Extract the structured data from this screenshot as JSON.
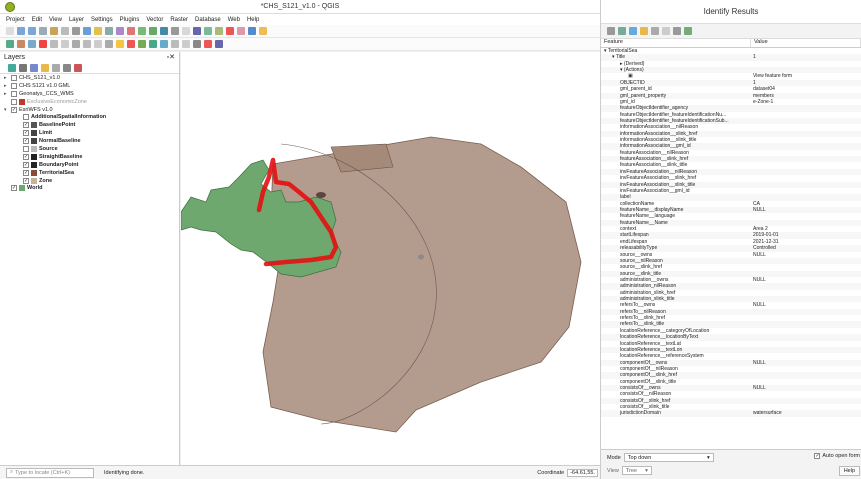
{
  "app": {
    "title": "*CHS_S121_v1.0 - QGIS"
  },
  "menu": [
    "Project",
    "Edit",
    "View",
    "Layer",
    "Settings",
    "Plugins",
    "Vector",
    "Raster",
    "Database",
    "Web",
    "Help"
  ],
  "layers_panel": {
    "title": "Layers",
    "items": [
      {
        "label": "CHS_S121_v1.0",
        "indent": 0,
        "checked": false,
        "expand": "closed",
        "bold": false,
        "grey": false,
        "swatch": ""
      },
      {
        "label": "CHS S121 v1.0 GML",
        "indent": 0,
        "checked": false,
        "expand": "closed",
        "bold": false,
        "grey": false,
        "swatch": ""
      },
      {
        "label": "Geonatys_CCS_WMS",
        "indent": 0,
        "checked": false,
        "expand": "closed",
        "bold": false,
        "grey": false,
        "swatch": ""
      },
      {
        "label": "ExclusiveEconomicZone",
        "indent": 0,
        "checked": false,
        "expand": "none",
        "bold": false,
        "grey": true,
        "swatch": "#c0392b"
      },
      {
        "label": "EsriWFS v1.0",
        "indent": 0,
        "checked": true,
        "expand": "open",
        "bold": false,
        "grey": false,
        "swatch": ""
      },
      {
        "label": "AdditionalSpatialInformation",
        "indent": 1,
        "checked": false,
        "expand": "none",
        "bold": true,
        "grey": false,
        "swatch": ""
      },
      {
        "label": "BaselinePoint",
        "indent": 1,
        "checked": true,
        "expand": "none",
        "bold": true,
        "grey": false,
        "swatch": "#555"
      },
      {
        "label": "Limit",
        "indent": 1,
        "checked": true,
        "expand": "none",
        "bold": true,
        "grey": false,
        "swatch": "#444"
      },
      {
        "label": "NormalBaseline",
        "indent": 1,
        "checked": true,
        "expand": "none",
        "bold": true,
        "grey": false,
        "swatch": "#444"
      },
      {
        "label": "Source",
        "indent": 1,
        "checked": false,
        "expand": "none",
        "bold": true,
        "grey": false,
        "swatch": "#bbb"
      },
      {
        "label": "StraightBaseline",
        "indent": 1,
        "checked": true,
        "expand": "none",
        "bold": true,
        "grey": false,
        "swatch": "#222"
      },
      {
        "label": "BoundaryPoint",
        "indent": 1,
        "checked": true,
        "expand": "none",
        "bold": true,
        "grey": false,
        "swatch": "#222"
      },
      {
        "label": "TerritorialSea",
        "indent": 1,
        "checked": true,
        "expand": "none",
        "bold": true,
        "grey": false,
        "swatch": "#8b4a3c"
      },
      {
        "label": "Zone",
        "indent": 1,
        "checked": true,
        "expand": "none",
        "bold": true,
        "grey": false,
        "swatch": "#c9b29c"
      },
      {
        "label": "World",
        "indent": 0,
        "checked": true,
        "expand": "none",
        "bold": true,
        "grey": false,
        "swatch": "#6fa86f"
      }
    ]
  },
  "status": {
    "locator_placeholder": "Type to locate (Ctrl+K)",
    "message": "Identifying done.",
    "coordinate_label": "Coordinate",
    "coordinate_value": "-64.61,55."
  },
  "identify": {
    "title": "Identify Results",
    "col_feature": "Feature",
    "col_value": "Value",
    "rows": [
      {
        "f": "TerritorialSea",
        "v": "",
        "i": 0,
        "exp": "open"
      },
      {
        "f": "Title",
        "v": "1",
        "i": 1,
        "exp": "open"
      },
      {
        "f": "(Derived)",
        "v": "",
        "i": 2,
        "exp": "closed"
      },
      {
        "f": "(Actions)",
        "v": "",
        "i": 2,
        "exp": "open"
      },
      {
        "f": "▣",
        "v": "View feature form",
        "i": 3,
        "exp": ""
      },
      {
        "f": "OBJECTID",
        "v": "1",
        "i": 2,
        "exp": ""
      },
      {
        "f": "gml_parent_id",
        "v": "dataset04",
        "i": 2,
        "exp": ""
      },
      {
        "f": "gml_parent_property",
        "v": "members",
        "i": 2,
        "exp": ""
      },
      {
        "f": "gml_id",
        "v": "e-Zone-1",
        "i": 2,
        "exp": ""
      },
      {
        "f": "featureObjectIdentifier_agency",
        "v": "",
        "i": 2,
        "exp": ""
      },
      {
        "f": "featureObjectIdentifier_featureIdentificationNu...",
        "v": "",
        "i": 2,
        "exp": ""
      },
      {
        "f": "featureObjectIdentifier_featureIdentificationSub...",
        "v": "",
        "i": 2,
        "exp": ""
      },
      {
        "f": "informationAssociation__nilReason",
        "v": "",
        "i": 2,
        "exp": ""
      },
      {
        "f": "informationAssociation__xlink_href",
        "v": "",
        "i": 2,
        "exp": ""
      },
      {
        "f": "informationAssociation__xlink_title",
        "v": "",
        "i": 2,
        "exp": ""
      },
      {
        "f": "informationAssociation__gml_id",
        "v": "",
        "i": 2,
        "exp": ""
      },
      {
        "f": "featureAssociation__nilReason",
        "v": "",
        "i": 2,
        "exp": ""
      },
      {
        "f": "featureAssociation__xlink_href",
        "v": "",
        "i": 2,
        "exp": ""
      },
      {
        "f": "featureAssociation__xlink_title",
        "v": "",
        "i": 2,
        "exp": ""
      },
      {
        "f": "invFeatureAssociation__nilReason",
        "v": "",
        "i": 2,
        "exp": ""
      },
      {
        "f": "invFeatureAssociation__xlink_href",
        "v": "",
        "i": 2,
        "exp": ""
      },
      {
        "f": "invFeatureAssociation__xlink_title",
        "v": "",
        "i": 2,
        "exp": ""
      },
      {
        "f": "invFeatureAssociation__gml_id",
        "v": "",
        "i": 2,
        "exp": ""
      },
      {
        "f": "label",
        "v": "",
        "i": 2,
        "exp": ""
      },
      {
        "f": "collectionName",
        "v": "CA",
        "i": 2,
        "exp": ""
      },
      {
        "f": "featureName__displayName",
        "v": "NULL",
        "i": 2,
        "exp": ""
      },
      {
        "f": "featureName__language",
        "v": "",
        "i": 2,
        "exp": ""
      },
      {
        "f": "featureName__Name",
        "v": "",
        "i": 2,
        "exp": ""
      },
      {
        "f": "context",
        "v": "Area 2",
        "i": 2,
        "exp": ""
      },
      {
        "f": "startLifespan",
        "v": "2019-01-01",
        "i": 2,
        "exp": ""
      },
      {
        "f": "endLifespan",
        "v": "2021-12-31",
        "i": 2,
        "exp": ""
      },
      {
        "f": "releasabilityType",
        "v": "Controlled",
        "i": 2,
        "exp": ""
      },
      {
        "f": "source__owns",
        "v": "NULL",
        "i": 2,
        "exp": ""
      },
      {
        "f": "source__nilReason",
        "v": "",
        "i": 2,
        "exp": ""
      },
      {
        "f": "source__xlink_href",
        "v": "",
        "i": 2,
        "exp": ""
      },
      {
        "f": "source__xlink_title",
        "v": "",
        "i": 2,
        "exp": ""
      },
      {
        "f": "administration__owns",
        "v": "NULL",
        "i": 2,
        "exp": ""
      },
      {
        "f": "administration_nilReason",
        "v": "",
        "i": 2,
        "exp": ""
      },
      {
        "f": "administration_xlink_href",
        "v": "",
        "i": 2,
        "exp": ""
      },
      {
        "f": "administration_xlink_title",
        "v": "",
        "i": 2,
        "exp": ""
      },
      {
        "f": "refersTo__owns",
        "v": "NULL",
        "i": 2,
        "exp": ""
      },
      {
        "f": "refersTo__nilReason",
        "v": "",
        "i": 2,
        "exp": ""
      },
      {
        "f": "refersTo__xlink_href",
        "v": "",
        "i": 2,
        "exp": ""
      },
      {
        "f": "refersTo__xlink_title",
        "v": "",
        "i": 2,
        "exp": ""
      },
      {
        "f": "locationReference__categoryOfLocation",
        "v": "",
        "i": 2,
        "exp": ""
      },
      {
        "f": "locationReference__locationByText",
        "v": "",
        "i": 2,
        "exp": ""
      },
      {
        "f": "locationReference__textLat",
        "v": "",
        "i": 2,
        "exp": ""
      },
      {
        "f": "locationReference__textLon",
        "v": "",
        "i": 2,
        "exp": ""
      },
      {
        "f": "locationReference__referenceSystem",
        "v": "",
        "i": 2,
        "exp": ""
      },
      {
        "f": "componentOf__owns",
        "v": "NULL",
        "i": 2,
        "exp": ""
      },
      {
        "f": "componentOf__nilReason",
        "v": "",
        "i": 2,
        "exp": ""
      },
      {
        "f": "componentOf__xlink_href",
        "v": "",
        "i": 2,
        "exp": ""
      },
      {
        "f": "componentOf__xlink_title",
        "v": "",
        "i": 2,
        "exp": ""
      },
      {
        "f": "consistsOf__owns",
        "v": "NULL",
        "i": 2,
        "exp": ""
      },
      {
        "f": "consistsOf__nilReason",
        "v": "",
        "i": 2,
        "exp": ""
      },
      {
        "f": "consistsOf__xlink_href",
        "v": "",
        "i": 2,
        "exp": ""
      },
      {
        "f": "consistsOf__xlink_title",
        "v": "",
        "i": 2,
        "exp": ""
      },
      {
        "f": "jurisdictionDomain",
        "v": "watersurface",
        "i": 2,
        "exp": ""
      }
    ],
    "mode_label": "Mode",
    "mode_value": "Top down",
    "auto_open_label": "Auto open form",
    "auto_open_checked": true,
    "view_label": "View",
    "view_value": "Tree",
    "help_label": "Help"
  },
  "colors": {
    "land": "#6fa86f",
    "territorial_sea": "#b49d8e",
    "zone_dark": "#a07f6c",
    "selection": "#e41010",
    "qgis_green": "#93b023"
  }
}
